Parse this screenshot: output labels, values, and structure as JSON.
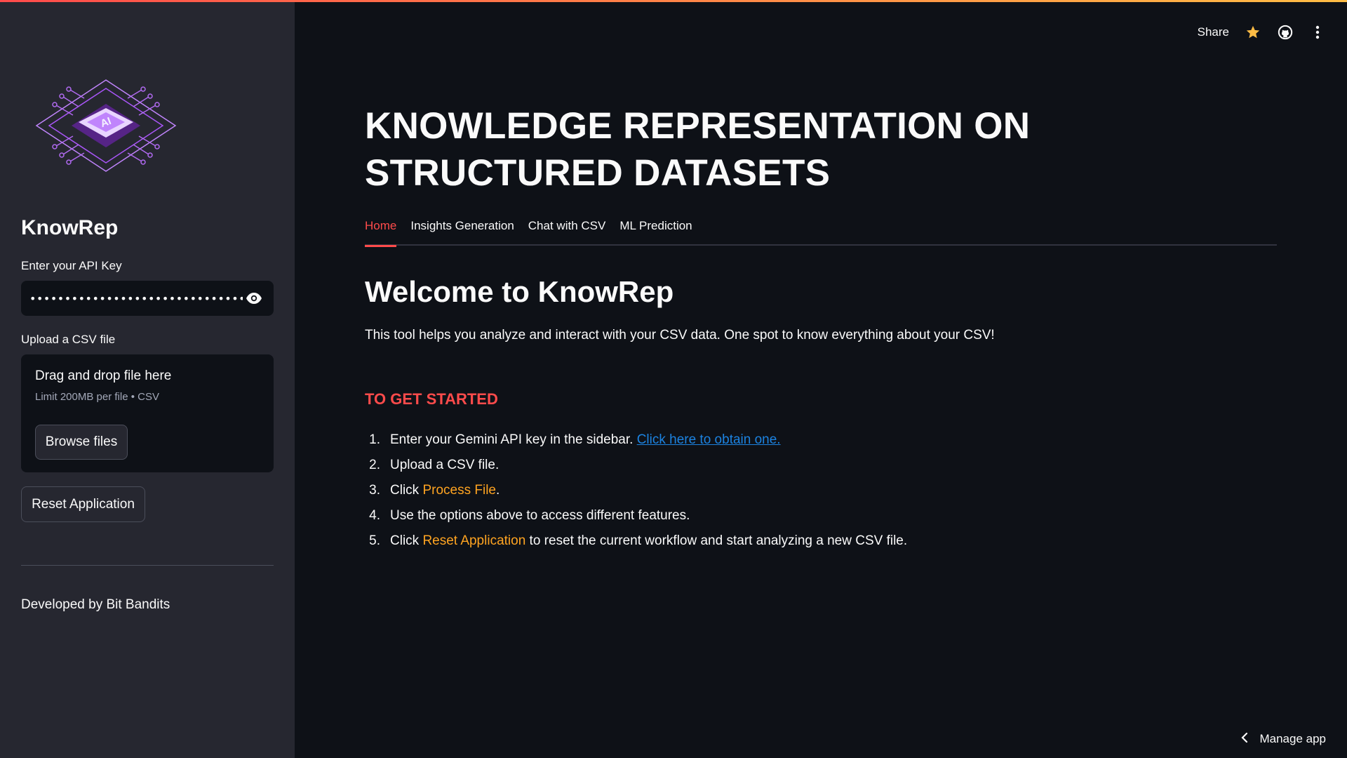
{
  "sidebar": {
    "app_name": "KnowRep",
    "api_key_label": "Enter your API Key",
    "api_key_value": "••••••••••••••••••••••••••••••••••••••",
    "upload_label": "Upload a CSV file",
    "dropzone_title": "Drag and drop file here",
    "dropzone_limit": "Limit 200MB per file • CSV",
    "browse_label": "Browse files",
    "reset_label": "Reset Application",
    "credit": "Developed by Bit Bandits"
  },
  "header": {
    "share_label": "Share",
    "icons": [
      "star-icon",
      "github-icon",
      "more-vertical-icon"
    ]
  },
  "main": {
    "title": "KNOWLEDGE REPRESENTATION ON STRUCTURED DATASETS",
    "tabs": [
      {
        "label": "Home",
        "active": true
      },
      {
        "label": "Insights Generation",
        "active": false
      },
      {
        "label": "Chat with CSV",
        "active": false
      },
      {
        "label": "ML Prediction",
        "active": false
      }
    ],
    "welcome": "Welcome to KnowRep",
    "intro": "This tool helps you analyze and interact with your CSV data. One spot to know everything about your CSV!",
    "get_started": "TO GET STARTED",
    "steps": [
      {
        "num": "1.",
        "pre": "Enter your Gemini API key in the sidebar. ",
        "link": "Click here to obtain one."
      },
      {
        "num": "2.",
        "text": "Upload a CSV file."
      },
      {
        "num": "3.",
        "pre": "Click ",
        "highlight": "Process File",
        "post": "."
      },
      {
        "num": "4.",
        "text": "Use the options above to access different features."
      },
      {
        "num": "5.",
        "pre": "Click ",
        "highlight": "Reset Application",
        "post": " to reset the current workflow and start analyzing a new CSV file."
      }
    ]
  },
  "footer": {
    "manage_app_label": "Manage app"
  },
  "colors": {
    "accent_red": "#ff4b4b",
    "highlight_orange": "#ffa421",
    "link_blue": "#1c83e1",
    "sidebar_bg": "#262730",
    "main_bg": "#0e1117"
  }
}
